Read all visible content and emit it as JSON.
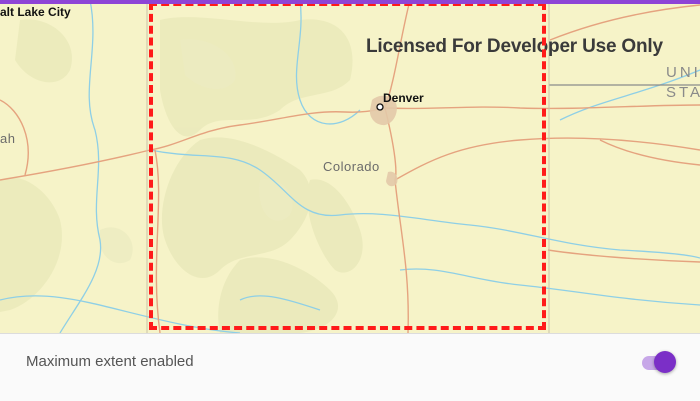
{
  "map": {
    "watermark": "Licensed For Developer Use Only",
    "labels": {
      "salt_lake_city": "alt Lake City",
      "denver": "Denver",
      "colorado": "Colorado",
      "utah_partial": "ah",
      "united_states_line1": "UNIT",
      "united_states_line2": "STA"
    },
    "extent_color": "#ff1a1a"
  },
  "settings": {
    "max_extent_label": "Maximum extent enabled",
    "max_extent_enabled": true
  },
  "colors": {
    "accent": "#7b2fc7",
    "accent_track": "#c7a7e8",
    "map_background": "#f6f3c8",
    "road": "#e5a37f",
    "river": "#8ecfe6"
  }
}
